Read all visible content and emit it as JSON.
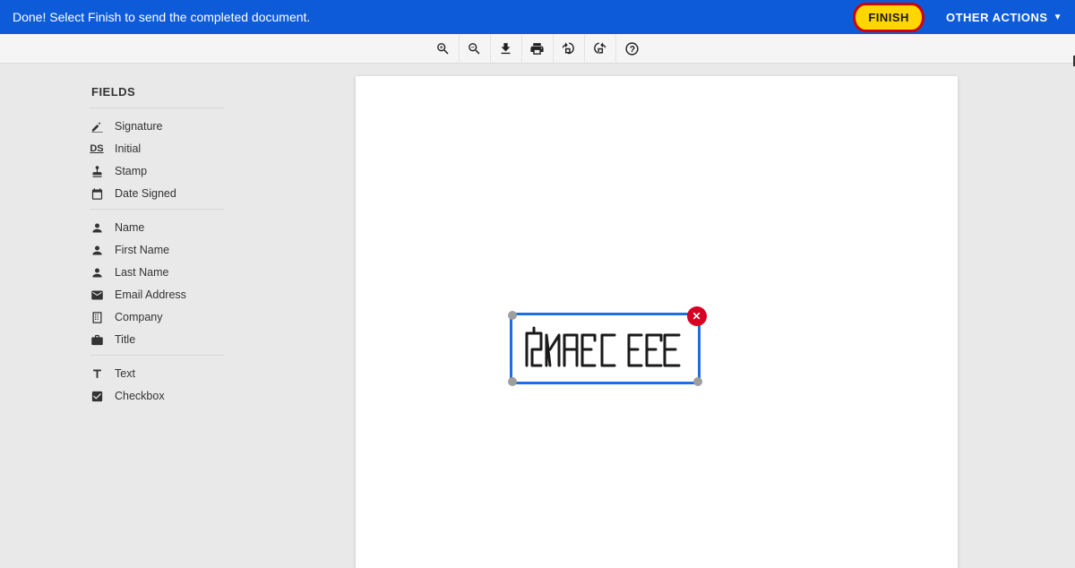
{
  "topbar": {
    "message": "Done! Select Finish to send the completed document.",
    "finish_label": "FINISH",
    "other_actions_label": "OTHER ACTIONS"
  },
  "sidebar": {
    "title": "FIELDS",
    "group1": [
      {
        "label": "Signature",
        "icon": "signature-icon"
      },
      {
        "label": "Initial",
        "icon": "initial-icon"
      },
      {
        "label": "Stamp",
        "icon": "stamp-icon"
      },
      {
        "label": "Date Signed",
        "icon": "date-signed-icon"
      }
    ],
    "group2": [
      {
        "label": "Name",
        "icon": "name-icon"
      },
      {
        "label": "First Name",
        "icon": "first-name-icon"
      },
      {
        "label": "Last Name",
        "icon": "last-name-icon"
      },
      {
        "label": "Email Address",
        "icon": "email-icon"
      },
      {
        "label": "Company",
        "icon": "company-icon"
      },
      {
        "label": "Title",
        "icon": "title-icon"
      }
    ],
    "group3": [
      {
        "label": "Text",
        "icon": "text-icon"
      },
      {
        "label": "Checkbox",
        "icon": "checkbox-icon"
      }
    ]
  },
  "signature": {
    "close_glyph": "✕"
  }
}
